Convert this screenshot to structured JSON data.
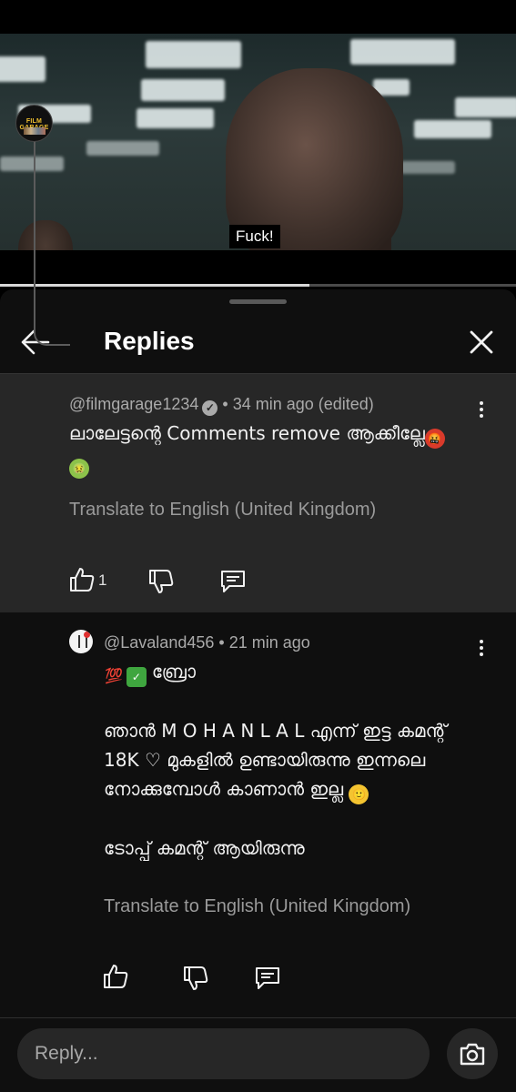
{
  "video": {
    "subtitle": "Fuck!",
    "progress": 0.6
  },
  "header": {
    "title": "Replies",
    "back_icon": "arrow-left-icon",
    "close_icon": "close-icon"
  },
  "parent_comment": {
    "author": "@filmgarage1234",
    "verified": true,
    "separator": "•",
    "time": "34 min ago (edited)",
    "avatar_text": "FILM GARAGE",
    "text_line1": "ലാലേട്ടന്റെ Comments remove ആക്കീല്ലേ",
    "translate_label": "Translate to English (United Kingdom)",
    "like_count": "1",
    "icons": {
      "like": "thumbs-up-icon",
      "dislike": "thumbs-down-icon",
      "reply": "comment-icon",
      "more": "more-vert-icon"
    }
  },
  "reply_comment": {
    "author": "@Lavaland456",
    "separator": "•",
    "time": "21 min ago",
    "line1_text": "ബ്രോ",
    "line2": "ഞാൻ M O  H A N L A L എന്ന് ഇട്ട കമന്റ്",
    "line3_pre": "18K",
    "line3_post": "മുകളിൽ ഉണ്ടായിരുന്നു ഇന്നലെ",
    "line4": "നോക്കുമ്പോൾ കാണാൻ ഇല്ല",
    "line5": "ടോപ്പ് കമന്റ് ആയിരുന്നു",
    "translate_label": "Translate to English (United Kingdom)",
    "icons": {
      "like": "thumbs-up-icon",
      "dislike": "thumbs-down-icon",
      "reply": "comment-icon",
      "more": "more-vert-icon"
    }
  },
  "reply_bar": {
    "placeholder": "Reply...",
    "camera_icon": "camera-icon"
  },
  "colors": {
    "sheet_bg": "#0f0f0f",
    "highlight_bg": "#272727",
    "secondary_text": "#aaaaaa"
  }
}
